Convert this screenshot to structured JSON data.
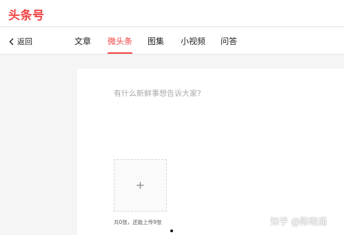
{
  "header": {
    "logo_text": "头条号"
  },
  "nav": {
    "back_label": "返回",
    "tabs": [
      {
        "label": "文章",
        "active": false
      },
      {
        "label": "微头条",
        "active": true
      },
      {
        "label": "图集",
        "active": false
      },
      {
        "label": "小视频",
        "active": false
      },
      {
        "label": "问答",
        "active": false
      }
    ]
  },
  "editor": {
    "placeholder": "有什么新鲜事想告诉大家?",
    "upload_icon": "plus-icon",
    "upload_hint": "共0张，还能上传9张"
  },
  "watermark": "知乎 @陈晓通",
  "colors": {
    "brand": "#f04142",
    "text": "#222222",
    "placeholder": "#aaaaaa",
    "background": "#f5f5f5"
  }
}
